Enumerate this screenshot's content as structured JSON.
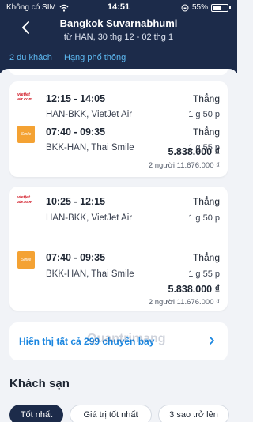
{
  "status_bar": {
    "carrier": "Không có SIM",
    "time": "14:51",
    "battery": "55%"
  },
  "header": {
    "title": "Bangkok Suvarnabhumi",
    "subtitle": "từ HAN, 30 thg 12 - 02 thg 1",
    "tabs": [
      {
        "label": "2 du khách"
      },
      {
        "label": "Hạng phổ thông"
      }
    ]
  },
  "results": [
    {
      "legs": [
        {
          "airline_logo": "VietJet",
          "time": "12:15 - 14:05",
          "route": "HAN-BKK, VietJet Air",
          "stops": "Thẳng",
          "duration": "1 g 50 p"
        },
        {
          "airline_logo": "Smile",
          "time": "07:40 - 09:35",
          "route": "BKK-HAN, Thai Smile",
          "stops": "Thẳng",
          "duration": "1 g 55 p"
        }
      ],
      "price": "5.838.000 ₫",
      "total": "2 người 11.676.000 ₫"
    },
    {
      "legs": [
        {
          "airline_logo": "VietJet",
          "time": "10:25 - 12:15",
          "route": "HAN-BKK, VietJet Air",
          "stops": "Thẳng",
          "duration": "1 g 50 p"
        },
        {
          "airline_logo": "Smile",
          "time": "07:40 - 09:35",
          "route": "BKK-HAN, Thai Smile",
          "stops": "Thẳng",
          "duration": "1 g 55 p"
        }
      ],
      "price": "5.838.000 ₫",
      "total": "2 người 11.676.000 ₫"
    }
  ],
  "show_all": "Hiển thị tất cả 299 chuyến bay",
  "hotels": {
    "title": "Khách sạn",
    "filters": [
      {
        "label": "Tốt nhất"
      },
      {
        "label": "Giá trị tốt nhất"
      },
      {
        "label": "3 sao trở lên"
      }
    ]
  },
  "watermark": "Quantrimang",
  "colors": {
    "header_bg": "#1c2b4a",
    "accent_tab": "#5db8f0",
    "link": "#1a86e0"
  },
  "icons": [
    "back-arrow-icon",
    "wifi-icon",
    "battery-icon",
    "chevron-right-icon"
  ]
}
